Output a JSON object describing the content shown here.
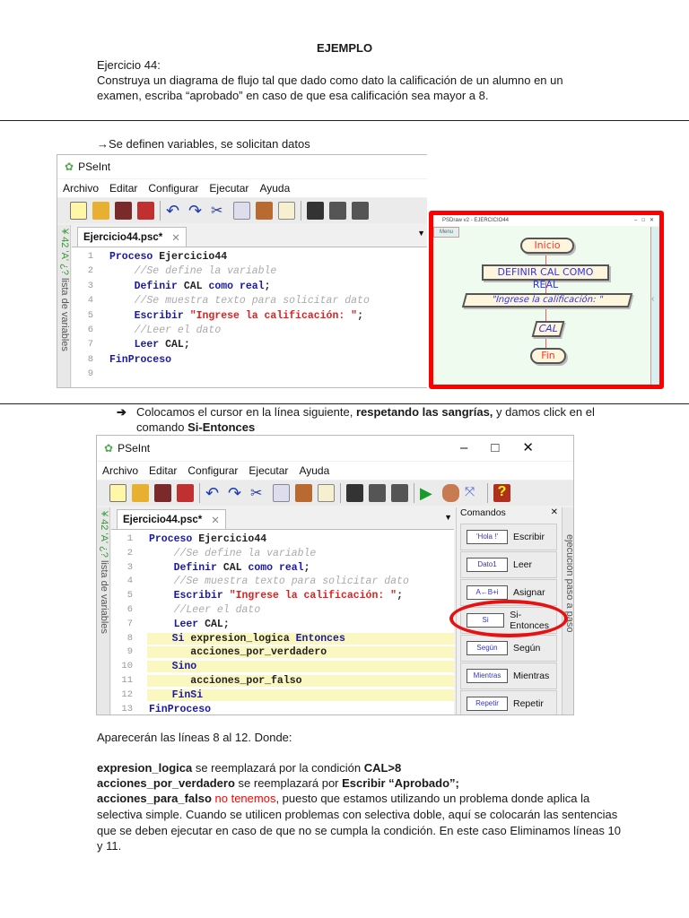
{
  "doc": {
    "title": "EJEMPLO",
    "exercise": "Ejercicio 44:",
    "statement_1": "Construya un diagrama de flujo tal que dado como dato la calificación de un alumno en un",
    "statement_2": "examen, escriba “aprobado” en caso de que esa calificación sea mayor a 8.",
    "step1": "→Se definen variables, se solicitan datos",
    "step2_a": "Colocamos el cursor en la línea siguiente, ",
    "step2_b": "respetando las sangrías,",
    "step2_c": " y damos click en el",
    "step2_d": "comando ",
    "step2_e": "Si-Entonces",
    "after": "Aparecerán las líneas 8 al 12. Donde:",
    "p1_b": "expresion_logica",
    "p1_t": " se reemplazará por la condición ",
    "p1_c": "CAL>8",
    "p2_b": "acciones_por_verdadero",
    "p2_t": " se reemplazará por ",
    "p2_c": "Escribir “Aprobado”;",
    "p3_b": "acciones_para_falso",
    "p3_red": " no tenemos",
    "p3_t": ", puesto que estamos utilizando un problema donde aplica la",
    "p4": "selectiva simple. Cuando se utilicen problemas con selectiva doble, aquí se colocarán las sentencias",
    "p5": "que se deben ejecutar en caso de que no se cumpla la condición. En este caso Eliminamos líneas 10",
    "p6": "y 11."
  },
  "app": {
    "name": "PSeInt",
    "menu": [
      "Archivo",
      "Editar",
      "Configurar",
      "Ejecutar",
      "Ayuda"
    ],
    "tab": "Ejercicio44.psc*",
    "side_label": "lista de variables",
    "side_icons": "¥ 42 'A' ¿?",
    "right_label": "ejecución paso a paso",
    "commands_title": "Comandos",
    "commands": [
      {
        "icon": "'Hola !'",
        "label": "Escribir"
      },
      {
        "icon": "Dato1",
        "label": "Leer"
      },
      {
        "icon": "A←B+i",
        "label": "Asignar"
      },
      {
        "icon": "Si",
        "label": "Si-Entonces"
      },
      {
        "icon": "Según",
        "label": "Según"
      },
      {
        "icon": "Mientras",
        "label": "Mientras"
      },
      {
        "icon": "Repetir",
        "label": "Repetir"
      }
    ]
  },
  "code1": [
    [
      [
        "Proceso ",
        "k"
      ],
      [
        "Ejercicio44",
        "n"
      ]
    ],
    [
      [
        "    //Se define la variable",
        "c"
      ]
    ],
    [
      [
        "    Definir ",
        "k"
      ],
      [
        "CAL ",
        "n"
      ],
      [
        "como real",
        "k"
      ],
      [
        ";",
        "n"
      ]
    ],
    [
      [
        "    //Se muestra texto para solicitar dato",
        "c"
      ]
    ],
    [
      [
        "    Escribir ",
        "k"
      ],
      [
        "\"Ingrese la calificación: \"",
        "s"
      ],
      [
        ";",
        "n"
      ]
    ],
    [
      [
        "    //Leer el dato",
        "c"
      ]
    ],
    [
      [
        "    Leer ",
        "k"
      ],
      [
        "CAL;",
        "n"
      ]
    ],
    [
      [
        "FinProceso",
        "k"
      ]
    ],
    []
  ],
  "code2": [
    [
      [
        "Proceso ",
        "k"
      ],
      [
        "Ejercicio44",
        "n"
      ]
    ],
    [
      [
        "    //Se define la variable",
        "c"
      ]
    ],
    [
      [
        "    Definir ",
        "k"
      ],
      [
        "CAL ",
        "n"
      ],
      [
        "como real",
        "k"
      ],
      [
        ";",
        "n"
      ]
    ],
    [
      [
        "    //Se muestra texto para solicitar dato",
        "c"
      ]
    ],
    [
      [
        "    Escribir ",
        "k"
      ],
      [
        "\"Ingrese la calificación: \"",
        "s"
      ],
      [
        ";",
        "n"
      ]
    ],
    [
      [
        "    //Leer el dato",
        "c"
      ]
    ],
    [
      [
        "    Leer ",
        "k"
      ],
      [
        "CAL;",
        "n"
      ]
    ],
    [
      [
        "    Si ",
        "k"
      ],
      [
        "expresion_logica",
        "n"
      ],
      [
        " Entonces",
        "k"
      ]
    ],
    [
      [
        "       acciones_por_verdadero",
        "n"
      ]
    ],
    [
      [
        "    Sino",
        "k"
      ]
    ],
    [
      [
        "       acciones_por_falso",
        "n"
      ]
    ],
    [
      [
        "    FinSi",
        "k"
      ]
    ],
    [
      [
        "FinProceso",
        "k"
      ]
    ]
  ],
  "flow": {
    "window_title": "PSDraw v2 - EJERCICIO44",
    "menu": "Menu",
    "start": "Inicio",
    "define": "DEFINIR CAL COMO REAL",
    "output": "\"Ingrese la calificación: \"",
    "input": "CAL",
    "end": "Fin"
  }
}
